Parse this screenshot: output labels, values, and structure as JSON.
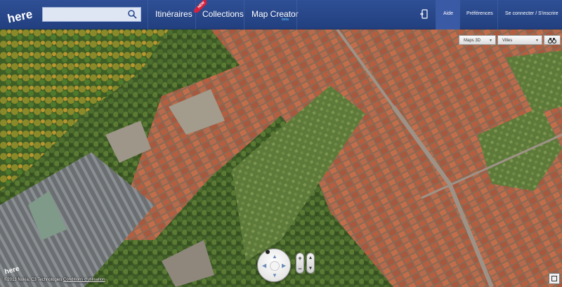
{
  "brand": {
    "logo_text": "here"
  },
  "search": {
    "value": "",
    "placeholder": ""
  },
  "nav": {
    "items": [
      {
        "label": "Itinéraires",
        "badge": "NEW"
      },
      {
        "label": "Collections"
      },
      {
        "label": "Map Creator",
        "badge": "beta"
      }
    ]
  },
  "top_right": {
    "aide": "Aide",
    "preferences": "Préférences",
    "login": "Se connecter / S'inscrire"
  },
  "map_controls": {
    "map_type": "Maps 3D",
    "layer": "Villes"
  },
  "footer": {
    "logo_text": "here",
    "copyright": "©2013 Nokia, C3 Technologies",
    "terms_link": "Conditions d'utilisation"
  },
  "colors": {
    "header": "#2a4a8f",
    "new_badge": "#d71f3a",
    "beta": "#5fc8ff",
    "roof": "#b8583a"
  }
}
